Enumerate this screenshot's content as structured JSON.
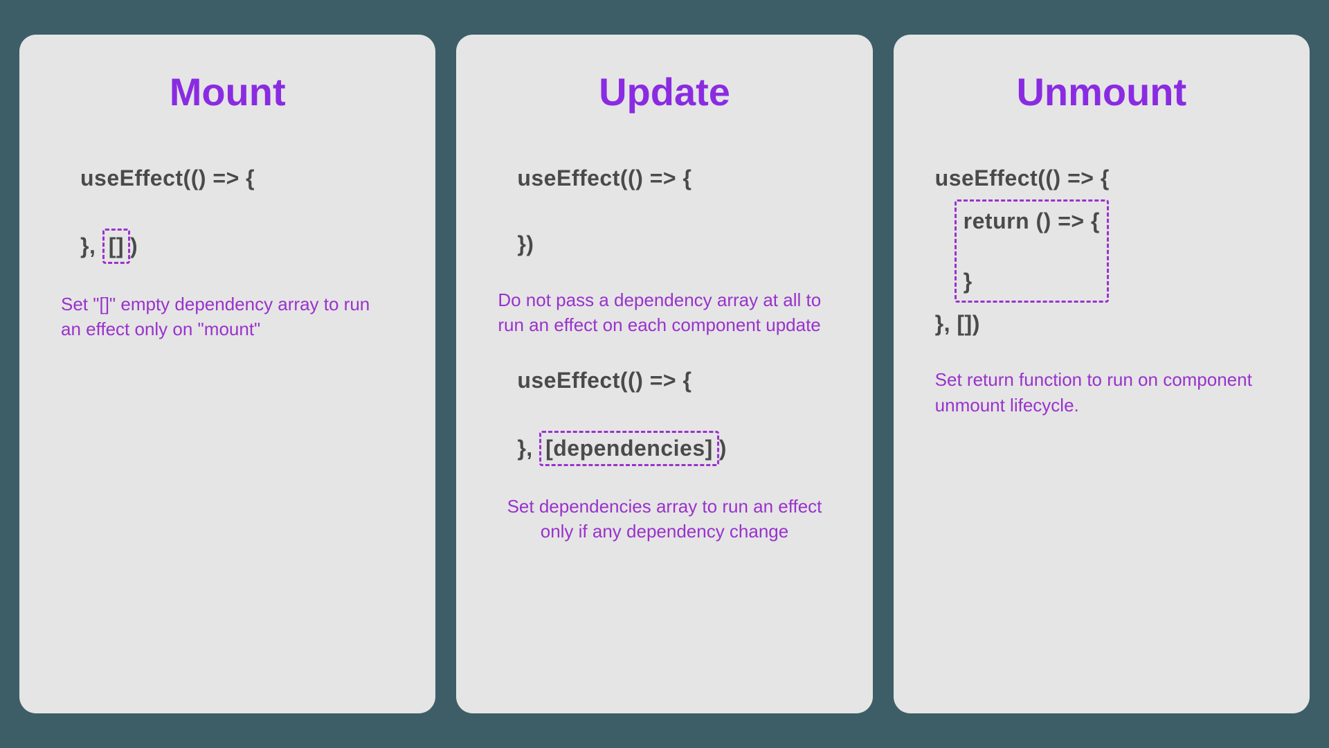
{
  "cards": {
    "mount": {
      "title": "Mount",
      "code": {
        "line1": "useEffect(() => {",
        "line2_prefix": "}, ",
        "line2_highlight": "[]",
        "line2_suffix": ")"
      },
      "description": "Set \"[]\" empty dependency array to run an effect only on \"mount\""
    },
    "update": {
      "title": "Update",
      "code1": {
        "line1": "useEffect(() => {",
        "line2": "})"
      },
      "description1": "Do not pass a dependency array at all to run an effect on each component update",
      "code2": {
        "line1": "useEffect(() => {",
        "line2_prefix": "}, ",
        "line2_highlight": "[dependencies]",
        "line2_suffix": ")"
      },
      "description2": "Set dependencies array to run an effect only if any dependency change"
    },
    "unmount": {
      "title": "Unmount",
      "code": {
        "line1": "useEffect(() => {",
        "return_line1": "return () => {",
        "return_line2": "}",
        "line_end": "}, [])"
      },
      "description": "Set return function to run on component unmount lifecycle."
    }
  }
}
